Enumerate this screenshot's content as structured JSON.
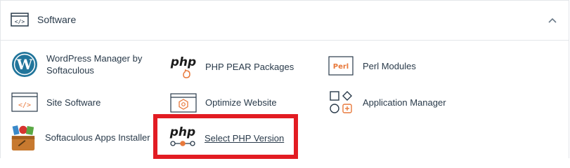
{
  "section": {
    "title": "Software",
    "header_icon": "code-window-icon",
    "collapse_icon": "chevron-up-icon"
  },
  "items": [
    {
      "label": "WordPress Manager by Softaculous",
      "icon": "wordpress-icon"
    },
    {
      "label": "PHP PEAR Packages",
      "icon": "php-pear-icon",
      "icon_text": "php"
    },
    {
      "label": "Perl Modules",
      "icon": "perl-icon",
      "icon_text": "Perl"
    },
    {
      "label": "Site Software",
      "icon": "code-window-icon"
    },
    {
      "label": "Optimize Website",
      "icon": "optimize-icon"
    },
    {
      "label": "Application Manager",
      "icon": "app-grid-icon"
    },
    {
      "label": "Softaculous Apps Installer",
      "icon": "softaculous-icon"
    },
    {
      "label": "Select PHP Version",
      "icon": "php-version-icon",
      "icon_text": "php"
    }
  ],
  "colors": {
    "accent_orange": "#e8793b",
    "text": "#293a4a",
    "highlight": "#e21c23",
    "wordpress_blue": "#21759b"
  }
}
